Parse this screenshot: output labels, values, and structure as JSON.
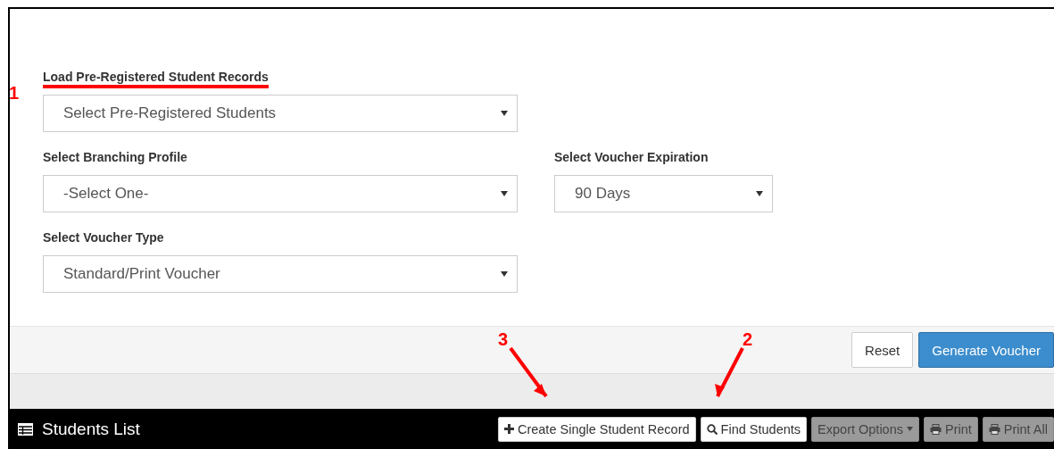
{
  "form": {
    "fields": [
      {
        "label": "Load Pre-Registered Student Records",
        "value": "Select Pre-Registered Students",
        "highlighted": true
      },
      {
        "label": "Select Branching Profile",
        "value": "-Select One-",
        "highlighted": false
      },
      {
        "label": "Select Voucher Expiration",
        "value": "90 Days",
        "highlighted": false
      },
      {
        "label": "Select Voucher Type",
        "value": "Standard/Print Voucher",
        "highlighted": false
      }
    ]
  },
  "actions": [
    {
      "label": "Reset",
      "kind": "default"
    },
    {
      "label": "Generate Voucher",
      "kind": "primary"
    }
  ],
  "panel": {
    "title": "Students List",
    "buttons": [
      {
        "label": "Create Single Student Record",
        "disabled": false,
        "caret": false
      },
      {
        "label": "Find Students",
        "disabled": false,
        "caret": false
      },
      {
        "label": "Export Options",
        "disabled": true,
        "caret": true
      },
      {
        "label": "Print",
        "disabled": true,
        "caret": false
      },
      {
        "label": "Print All",
        "disabled": true,
        "caret": false
      }
    ]
  },
  "annotations": [
    {
      "text": "1",
      "kind": "number"
    },
    {
      "text": "3",
      "kind": "arrow"
    },
    {
      "text": "2",
      "kind": "arrow"
    }
  ]
}
